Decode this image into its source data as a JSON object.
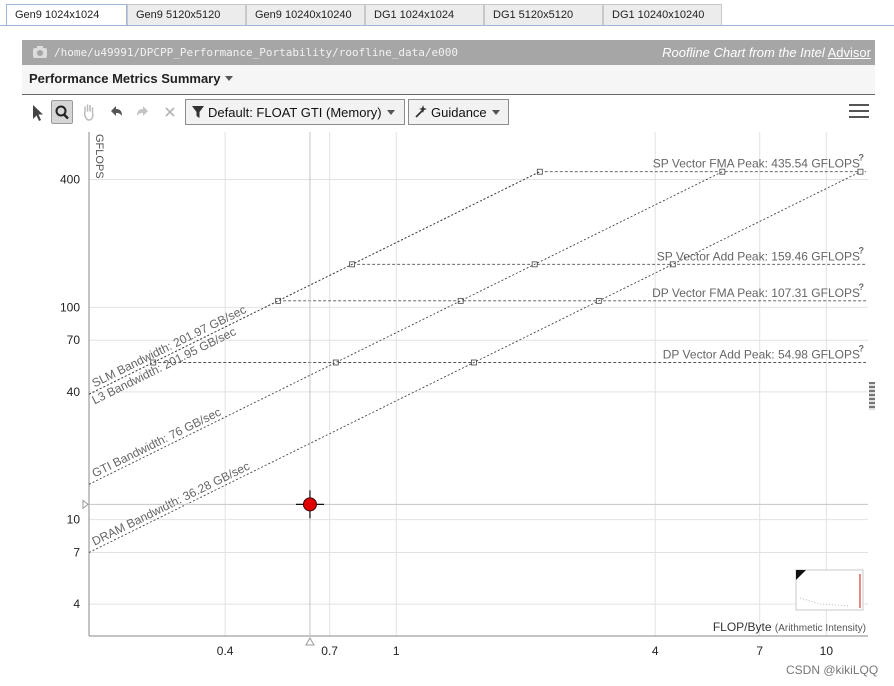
{
  "tabs": [
    {
      "label": "Gen9 1024x1024",
      "active": true
    },
    {
      "label": "Gen9 5120x5120",
      "active": false
    },
    {
      "label": "Gen9 10240x10240",
      "active": false
    },
    {
      "label": "DG1 1024x1024",
      "active": false
    },
    {
      "label": "DG1 5120x5120",
      "active": false
    },
    {
      "label": "DG1 10240x10240",
      "active": false
    }
  ],
  "header": {
    "path": "/home/u49991/DPCPP_Performance_Portability/roofline_data/e000",
    "brand_prefix": "Roofline Chart from the Intel",
    "brand_link": "Advisor"
  },
  "summary": {
    "label": "Performance Metrics Summary"
  },
  "toolbar": {
    "filter_label": "Default: FLOAT GTI (Memory)",
    "guidance_label": "Guidance"
  },
  "chart_data": {
    "type": "scatter",
    "title": "",
    "xlabel": "FLOP/Byte",
    "xlabel_note": "(Arithmetic Intensity)",
    "ylabel": "GFLOPS",
    "x_scale": "log",
    "y_scale": "log",
    "xlim": [
      0.193,
      12.5
    ],
    "ylim": [
      2.83,
      670
    ],
    "x_ticks": [
      0.4,
      0.7,
      1,
      4,
      7,
      10
    ],
    "y_ticks": [
      4,
      7,
      10,
      40,
      70,
      100,
      400
    ],
    "grid": true,
    "roofs": [
      {
        "label": "SP Vector FMA Peak: 435.54 GFLOPS",
        "gflops": 435.54
      },
      {
        "label": "SP Vector Add Peak: 159.46 GFLOPS",
        "gflops": 159.46
      },
      {
        "label": "DP Vector FMA Peak: 107.31 GFLOPS",
        "gflops": 107.31
      },
      {
        "label": "DP Vector Add Peak: 54.98 GFLOPS",
        "gflops": 54.98
      }
    ],
    "bandwidths": [
      {
        "label": "SLM Bandwidth: 201.97 GB/sec",
        "gbps": 201.97
      },
      {
        "label": "L3 Bandwidth: 201.95 GB/sec",
        "gbps": 201.95
      },
      {
        "label": "GTI Bandwidth: 76 GB/sec",
        "gbps": 76
      },
      {
        "label": "DRAM Bandwidth: 36.28 GB/sec",
        "gbps": 36.28
      }
    ],
    "points": [
      {
        "x": 0.63,
        "y": 11.8,
        "color": "#e00000"
      }
    ]
  },
  "watermark": "CSDN @kikiLQQ"
}
